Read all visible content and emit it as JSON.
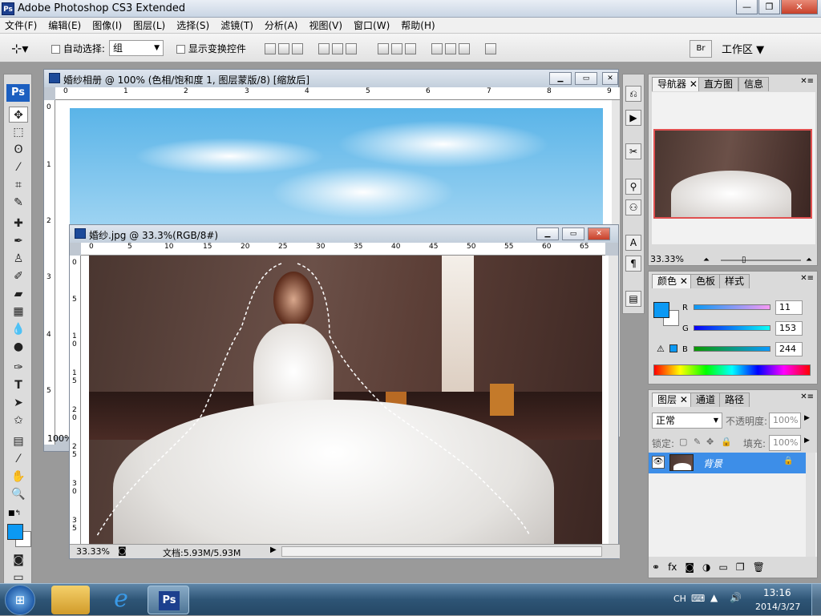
{
  "app": {
    "title": "Adobe Photoshop CS3 Extended",
    "icon": "Ps"
  },
  "window_controls": {
    "minimize": "—",
    "restore": "❐",
    "close": "✕"
  },
  "menu": [
    "文件(F)",
    "编辑(E)",
    "图像(I)",
    "图层(L)",
    "选择(S)",
    "滤镜(T)",
    "分析(A)",
    "视图(V)",
    "窗口(W)",
    "帮助(H)"
  ],
  "options": {
    "auto_select_label": "自动选择:",
    "auto_select_value": "组",
    "show_transform_label": "显示变换控件",
    "workspace_label": "工作区"
  },
  "doc_back": {
    "title": "婚纱相册 @ 100% (色相/饱和度 1, 图层蒙版/8) [缩放后]",
    "ruler_h": [
      "0",
      "1",
      "2",
      "3",
      "4",
      "5",
      "6",
      "7",
      "8",
      "9"
    ],
    "ruler_v": [
      "0",
      "1",
      "2",
      "3",
      "4",
      "5"
    ],
    "zoom": "100%"
  },
  "doc_front": {
    "title": "婚纱.jpg @ 33.3%(RGB/8#)",
    "ruler_h": [
      "0",
      "5",
      "10",
      "15",
      "20",
      "25",
      "30",
      "35",
      "40",
      "45",
      "50",
      "55",
      "60",
      "65"
    ],
    "ruler_v": [
      "0",
      "5",
      "1 0",
      "1 5",
      "2 0",
      "2 5",
      "3 0",
      "3 5"
    ],
    "zoom": "33.33%",
    "doc_size": "文档:5.93M/5.93M"
  },
  "navigator": {
    "tabs": [
      "导航器",
      "直方图",
      "信息"
    ],
    "zoom": "33.33%"
  },
  "color": {
    "tabs": [
      "颜色",
      "色板",
      "样式"
    ],
    "channels": [
      {
        "label": "R",
        "value": "11"
      },
      {
        "label": "G",
        "value": "153"
      },
      {
        "label": "B",
        "value": "244"
      }
    ],
    "fg_color": "#0b99f4",
    "bg_color": "#ffffff"
  },
  "layers": {
    "tabs": [
      "图层",
      "通道",
      "路径"
    ],
    "blend_mode": "正常",
    "opacity_label": "不透明度:",
    "opacity_value": "100%",
    "lock_label": "锁定:",
    "fill_label": "填充:",
    "fill_value": "100%",
    "items": [
      {
        "name": "背景",
        "selected": true,
        "locked": true
      }
    ]
  },
  "taskbar": {
    "time": "13:16",
    "date": "2014/3/27",
    "lang": "CH"
  }
}
